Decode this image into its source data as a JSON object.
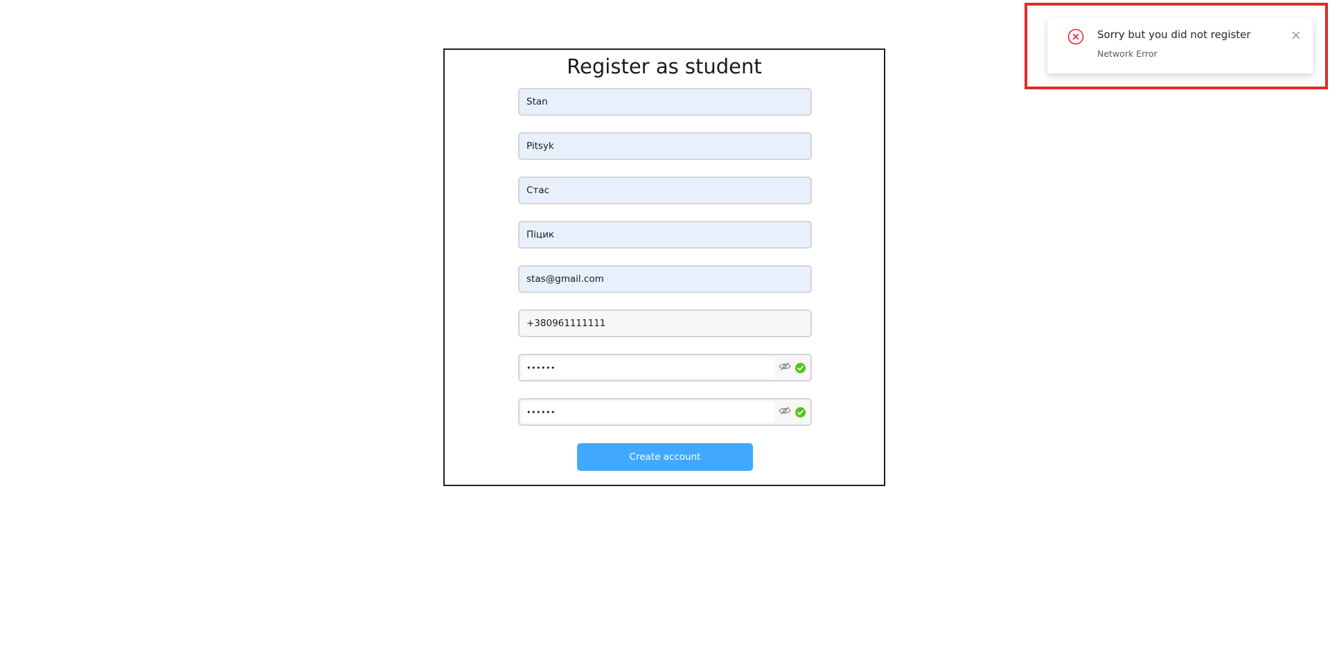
{
  "form": {
    "title": "Register as student",
    "fields": [
      {
        "value": "Stan"
      },
      {
        "value": "Pitsyk"
      },
      {
        "value": "Стас"
      },
      {
        "value": "Піцик"
      },
      {
        "value": "stas@gmail.com"
      },
      {
        "value": "+380961111111"
      },
      {
        "value": "••••••",
        "icon": "eye-invisible-icon",
        "status_icon": "check-circle-icon"
      },
      {
        "value": "••••••",
        "icon": "eye-invisible-icon",
        "status_icon": "check-circle-icon"
      }
    ],
    "submit_label": "Create account",
    "accent_color": "#40a9ff",
    "success_color": "#52c41a"
  },
  "notification": {
    "title": "Sorry but you did not register",
    "description": "Network Error",
    "icon": "close-circle-icon",
    "close_icon": "close-icon",
    "error_color": "#e02a2a"
  }
}
